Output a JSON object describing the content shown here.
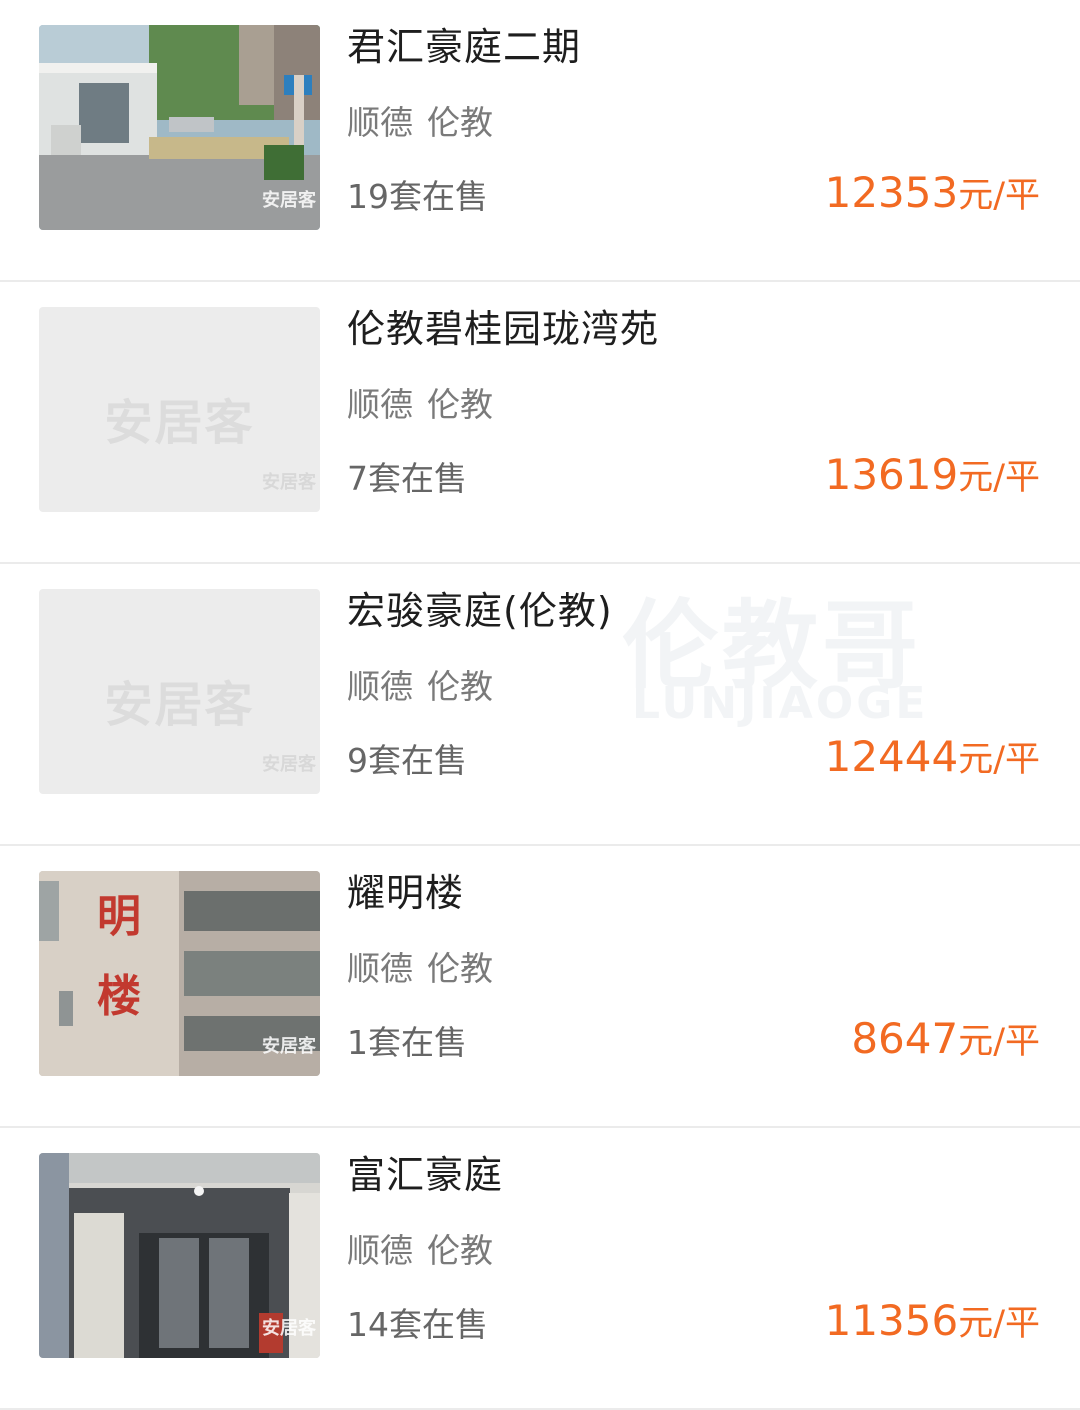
{
  "watermark": {
    "cn": "伦教哥",
    "en": "LUNJIAOGE"
  },
  "listings": [
    {
      "name": "君汇豪庭二期",
      "district": "顺德",
      "town": "伦教",
      "count": "19套在售",
      "price_value": "12353",
      "price_unit": "元/平",
      "image": "gate-photo",
      "image_mark": "安居客"
    },
    {
      "name": "伦教碧桂园珑湾苑",
      "district": "顺德",
      "town": "伦教",
      "count": "7套在售",
      "price_value": "13619",
      "price_unit": "元/平",
      "image": "placeholder",
      "placeholder_logo": "安居客",
      "image_mark": "安居客"
    },
    {
      "name": "宏骏豪庭(伦教)",
      "district": "顺德",
      "town": "伦教",
      "count": "9套在售",
      "price_value": "12444",
      "price_unit": "元/平",
      "image": "placeholder",
      "placeholder_logo": "安居客",
      "image_mark": "安居客"
    },
    {
      "name": "耀明楼",
      "district": "顺德",
      "town": "伦教",
      "count": "1套在售",
      "price_value": "8647",
      "price_unit": "元/平",
      "image": "building-photo",
      "image_mark": "安居客"
    },
    {
      "name": "富汇豪庭",
      "district": "顺德",
      "town": "伦教",
      "count": "14套在售",
      "price_value": "11356",
      "price_unit": "元/平",
      "image": "entrance-photo",
      "image_mark": "安居客"
    }
  ]
}
